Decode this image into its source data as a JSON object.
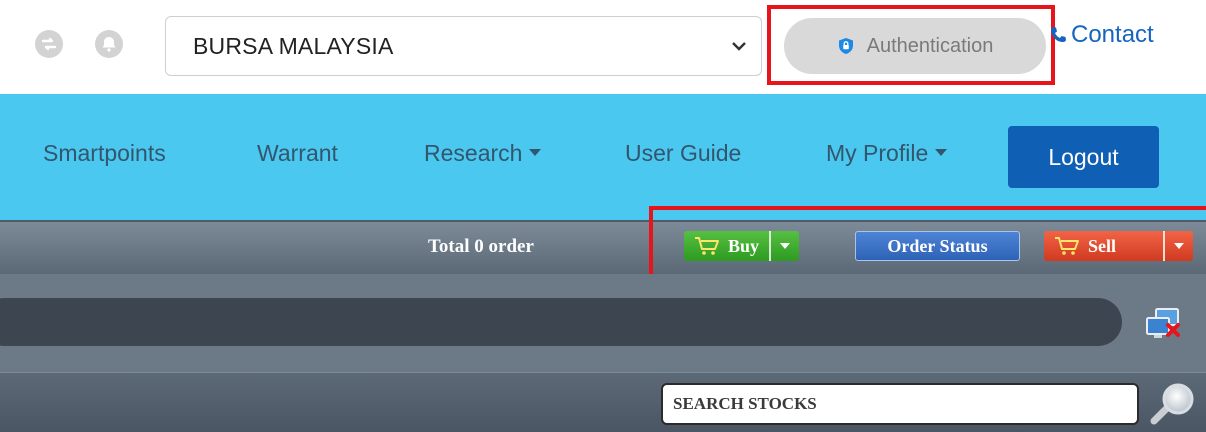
{
  "topbar": {
    "market_select": {
      "value": "BURSA MALAYSIA"
    },
    "authentication_label": "Authentication",
    "contact_label": "Contact",
    "icons": [
      "transfer-icon",
      "alarm-bell-icon",
      "shield-icon",
      "phone-icon",
      "chevron-down-icon"
    ]
  },
  "nav": {
    "items": [
      {
        "label": "Smartpoints"
      },
      {
        "label": "Warrant"
      },
      {
        "label": "Research",
        "dropdown": true
      },
      {
        "label": "User Guide"
      },
      {
        "label": "My Profile",
        "dropdown": true
      }
    ],
    "logout_label": "Logout",
    "colors": {
      "nav_bg": "#4ac8ef",
      "logout_bg": "#0f5fb4"
    }
  },
  "orders": {
    "total_label": "Total 0 order",
    "buy_label": "Buy",
    "order_status_label": "Order Status",
    "sell_label": "Sell",
    "colors": {
      "buy": "#3aa82c",
      "order_status": "#3a6fc4",
      "sell": "#e04a2c"
    }
  },
  "search": {
    "placeholder": "SEARCH STOCKS"
  },
  "highlight_color": "#e8141b"
}
